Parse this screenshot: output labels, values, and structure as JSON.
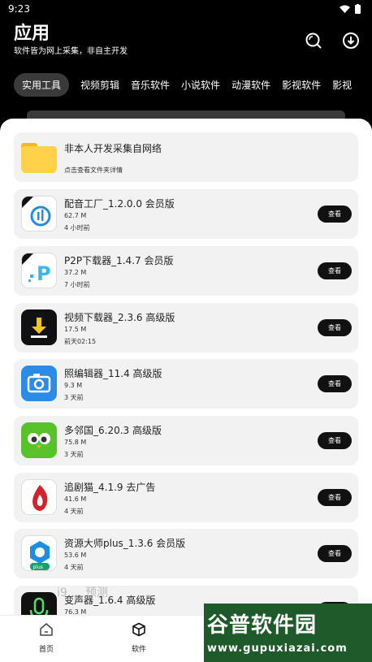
{
  "status": {
    "time": "9:23"
  },
  "header": {
    "title": "应用",
    "subtitle": "软件皆为网上采集，非自主开发"
  },
  "tabs": [
    "实用工具",
    "视频剪辑",
    "音乐软件",
    "小说软件",
    "动漫软件",
    "影视软件",
    "影视"
  ],
  "folder": {
    "title": "非本人开发采集自网络",
    "subtitle": "点击查看文件夹详情"
  },
  "apps": [
    {
      "name": "配音工厂_1.2.0.0 会员版",
      "size": "62.7 M",
      "time": "4 小时前",
      "button": "查看"
    },
    {
      "name": "P2P下载器_1.4.7 会员版",
      "size": "37.2 M",
      "time": "7 小时前",
      "button": "查看"
    },
    {
      "name": "视频下载器_2.3.6 高级版",
      "size": "17.5 M",
      "time": "前天02:15",
      "button": "查看"
    },
    {
      "name": "照编辑器_11.4 高级版",
      "size": "9.3 M",
      "time": "3 天前",
      "button": "查看"
    },
    {
      "name": "多邻国_6.20.3 高级版",
      "size": "75.8 M",
      "time": "3 天前",
      "button": "查看"
    },
    {
      "name": "追剧猫_4.1.9 去广告",
      "size": "41.6 M",
      "time": "4 天前",
      "button": "查看"
    },
    {
      "name": "资源大师plus_1.3.6 会员版",
      "size": "53.6 M",
      "time": "4 天前",
      "button": "查看"
    },
    {
      "name": "变声器_1.6.4 高级版",
      "size": "76.3 M",
      "time": "",
      "button": "查看"
    }
  ],
  "overlay_text": "i9 ... 预测",
  "nav": {
    "home": "首页",
    "software": "软件"
  },
  "watermark": {
    "title": "谷普软件园",
    "url": "www.gupuxiazai.com"
  },
  "colors": {
    "background": "#000000",
    "sheet": "#ffffff",
    "card": "#f2f2f2",
    "button": "#111111",
    "watermark": "#1f5a2b"
  },
  "icons": [
    "search-icon",
    "download-icon",
    "folder-icon",
    "home-icon",
    "box-icon"
  ]
}
